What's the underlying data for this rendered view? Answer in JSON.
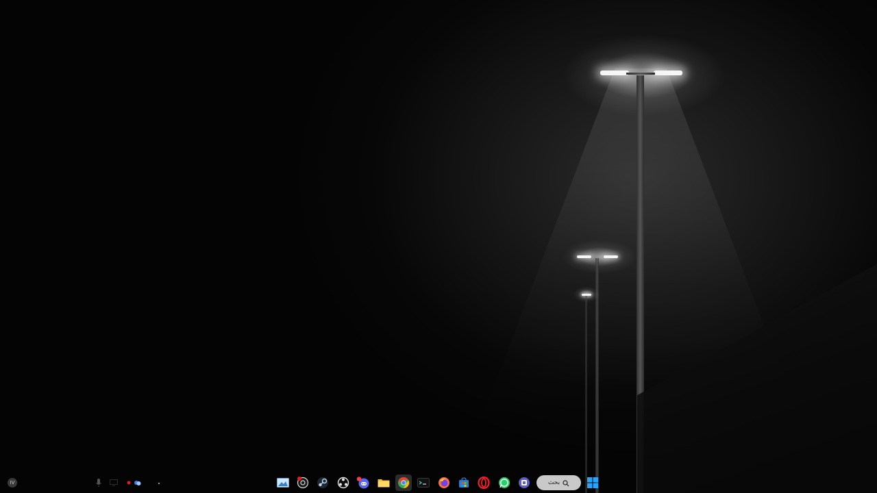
{
  "desktop": {
    "wallpaper": "foggy-night-street-lamps",
    "background_color": "#050505"
  },
  "taskbar": {
    "left_badge_text": "IV",
    "tray": [
      {
        "name": "microphone-icon"
      },
      {
        "name": "display-icon"
      },
      {
        "name": "record-indicator-icon",
        "color": "#e11d1d"
      },
      {
        "name": "cloud-sync-icon",
        "color": "#3b82f6"
      }
    ],
    "apps": [
      {
        "name": "photos-app-icon"
      },
      {
        "name": "screen-recorder-app-icon"
      },
      {
        "name": "steam-app-icon"
      },
      {
        "name": "obs-app-icon"
      },
      {
        "name": "discord-app-icon",
        "badge": true
      },
      {
        "name": "file-explorer-app-icon"
      },
      {
        "name": "chrome-app-icon",
        "active": true
      },
      {
        "name": "terminal-app-icon"
      },
      {
        "name": "firefox-app-icon"
      },
      {
        "name": "microsoft-store-app-icon"
      },
      {
        "name": "opera-app-icon"
      },
      {
        "name": "whatsapp-app-icon"
      },
      {
        "name": "teams-app-icon"
      }
    ],
    "search": {
      "label": "بحث"
    },
    "start_button": "windows-start-icon",
    "accent_color": "#29a3ff"
  }
}
